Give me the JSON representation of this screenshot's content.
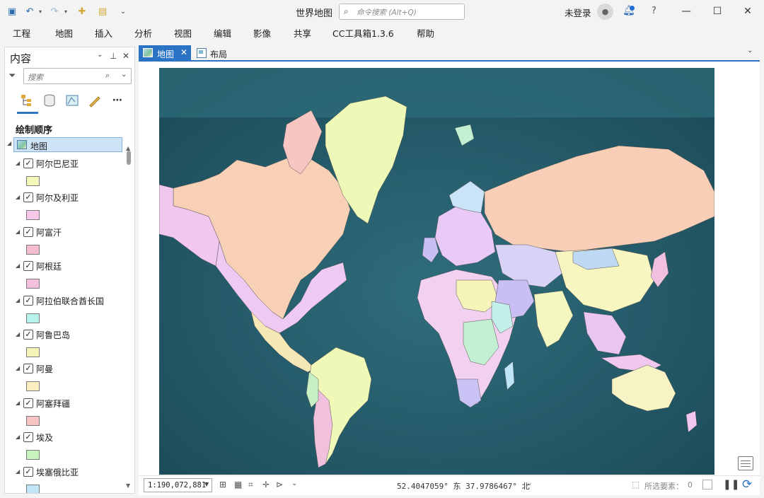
{
  "window": {
    "title": "世界地图",
    "search_placeholder": "命令搜索 (Alt+Q)",
    "user": "未登录",
    "help": "?"
  },
  "quick_access": [
    "project-icon",
    "undo-icon",
    "redo-icon",
    "new-icon",
    "open-icon",
    "customize-icon"
  ],
  "menu": [
    "工程",
    "地图",
    "插入",
    "分析",
    "视图",
    "编辑",
    "影像",
    "共享",
    "CC工具箱1.3.6",
    "帮助"
  ],
  "contents_pane": {
    "title": "内容",
    "search_placeholder": "搜索",
    "section_heading": "绘制顺序",
    "root": "地图",
    "layers": [
      {
        "name": "阿尔巴尼亚",
        "color": "#f5f8b8"
      },
      {
        "name": "阿尔及利亚",
        "color": "#f7c7ea"
      },
      {
        "name": "阿富汗",
        "color": "#f6bdd0"
      },
      {
        "name": "阿根廷",
        "color": "#f4bfdc"
      },
      {
        "name": "阿拉伯联合酋长国",
        "color": "#b7f3ec"
      },
      {
        "name": "阿鲁巴岛",
        "color": "#f6f4b8"
      },
      {
        "name": "阿曼",
        "color": "#fbeec0"
      },
      {
        "name": "阿塞拜疆",
        "color": "#f8c3c3"
      },
      {
        "name": "埃及",
        "color": "#c7f4bd"
      },
      {
        "name": "埃塞俄比亚",
        "color": "#bfe6f6"
      }
    ]
  },
  "tabs": [
    {
      "label": "地图",
      "active": true
    },
    {
      "label": "布局",
      "active": false
    }
  ],
  "status": {
    "scale": "1:190,072,881",
    "coordinates": "52.4047059° 东  37.9786467° 北",
    "selected_label": "所选要素：",
    "selected_count": "0"
  },
  "colors": {
    "accent": "#2a73c5",
    "ocean": "#2e6a79",
    "ocean_deep": "#1f4e5c"
  }
}
